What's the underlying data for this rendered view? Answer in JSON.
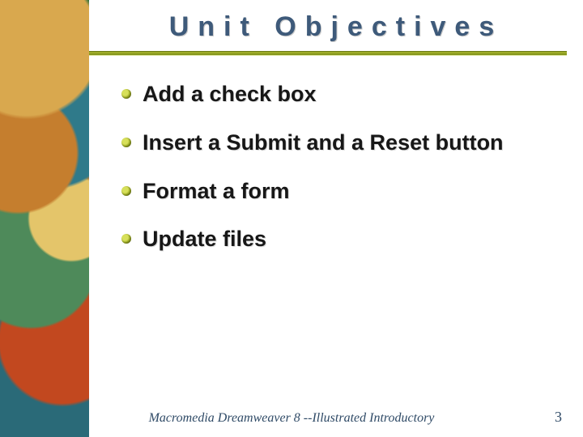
{
  "title": "Unit Objectives",
  "objectives": [
    {
      "text": "Add a check box"
    },
    {
      "text": "Insert a Submit and a Reset button"
    },
    {
      "text": "Format a form"
    },
    {
      "text": "Update files"
    }
  ],
  "footer": "Macromedia Dreamweaver 8 --Illustrated Introductory",
  "page_number": "3"
}
